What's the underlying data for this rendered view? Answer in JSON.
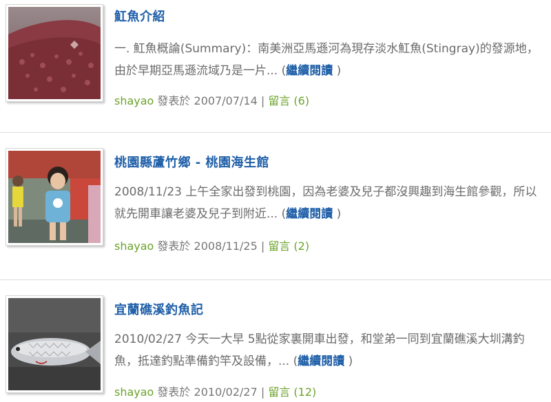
{
  "posts": [
    {
      "title": "魟魚介紹",
      "excerpt": "一. 魟魚概論(Summary)：南美洲亞馬遜河為現存淡水魟魚(Stingray)的發源地，由於早期亞馬遜流域乃是一片... ",
      "more_open": "(",
      "more_label": "繼續閱讀",
      "more_close": " )",
      "author": "shayao",
      "posted_label": " 發表於 ",
      "date": "2007/07/14",
      "separator": " | ",
      "comments_label": "留言 (6)",
      "thumb_alt": "stingray-photo"
    },
    {
      "title": "桃園縣蘆竹鄉 - 桃園海生館",
      "excerpt": "2008/11/23 上午全家出發到桃園，因為老婆及兒子都沒興趣到海生館參觀，所以就先開車讓老婆及兒子到附近... ",
      "more_open": "(",
      "more_label": "繼續閱讀",
      "more_close": " )",
      "author": "shayao",
      "posted_label": " 發表於 ",
      "date": "2008/11/25",
      "separator": " | ",
      "comments_label": "留言 (2)",
      "thumb_alt": "kids-photo"
    },
    {
      "title": "宜蘭礁溪釣魚記",
      "excerpt": "2010/02/27 今天一大早 5點從家裏開車出發，和堂弟一同到宜蘭礁溪大圳溝釣魚，抵達釣點準備釣竿及設備，... ",
      "more_open": "(",
      "more_label": "繼續閱讀",
      "more_close": " )",
      "author": "shayao",
      "posted_label": " 發表於 ",
      "date": "2010/02/27",
      "separator": " | ",
      "comments_label": "留言 (12)",
      "thumb_alt": "fish-photo"
    }
  ]
}
